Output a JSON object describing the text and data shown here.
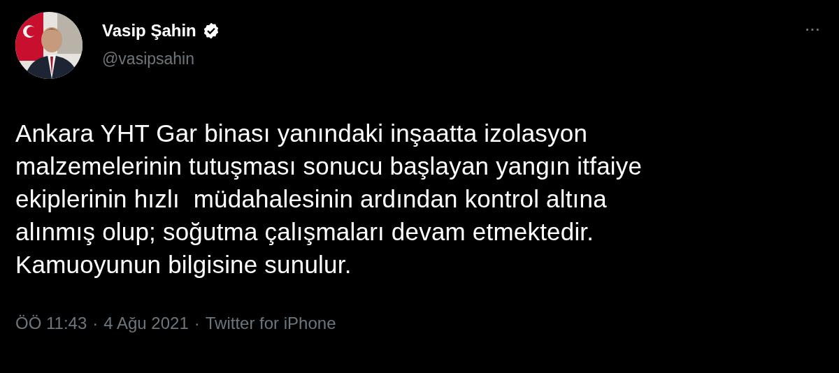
{
  "author": {
    "name": "Vasip Şahin",
    "verified": true,
    "handle": "@vasipsahin"
  },
  "more_menu": "···",
  "tweet": {
    "text": "Ankara YHT Gar binası yanındaki inşaatta izolasyon\nmalzemelerinin tutuşması sonucu başlayan yangın itfaiye\nekiplerinin hızlı  müdahalesinin ardından kontrol altına\nalınmış olup; soğutma çalışmaları devam etmektedir.\nKamuoyunun bilgisine sunulur."
  },
  "meta": [
    "ÖÖ 11:43",
    "4 Ağu 2021",
    "Twitter for iPhone"
  ],
  "meta_separator": "·"
}
